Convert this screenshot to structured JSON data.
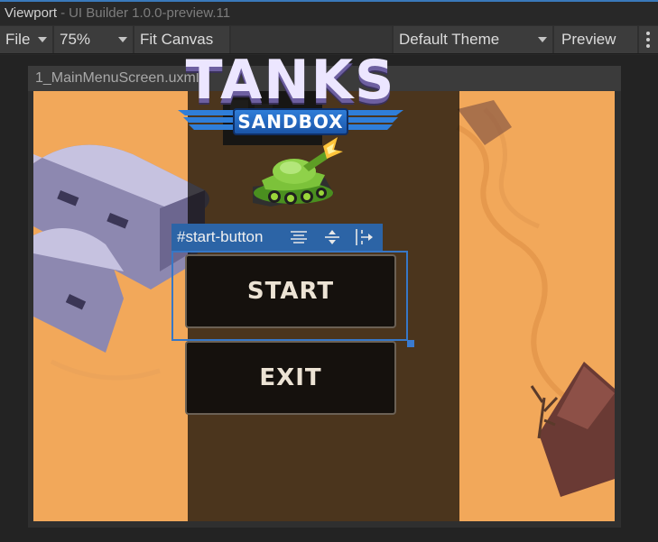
{
  "window": {
    "panel_name": "Viewport",
    "separator": "-",
    "app_title": "UI Builder 1.0.0-preview.11"
  },
  "toolbar": {
    "file_label": "File",
    "zoom_value": "75%",
    "fit_canvas_label": "Fit Canvas",
    "theme_value": "Default Theme",
    "preview_label": "Preview",
    "more_icon": "vertical-ellipsis-icon"
  },
  "document": {
    "file_name": "1_MainMenuScreen.uxml"
  },
  "game_ui": {
    "logo_title": "TANKS",
    "logo_subtitle": "SANDBOX",
    "start_label": "START",
    "exit_label": "EXIT"
  },
  "selection": {
    "element_name": "#start-button",
    "icons": [
      "align-justify-icon",
      "align-center-icon",
      "flex-direction-icon"
    ]
  },
  "colors": {
    "accent": "#2c64a6",
    "selection_border": "#3777c6",
    "desert": "#f2a85a",
    "button_text": "#ece3d4"
  }
}
